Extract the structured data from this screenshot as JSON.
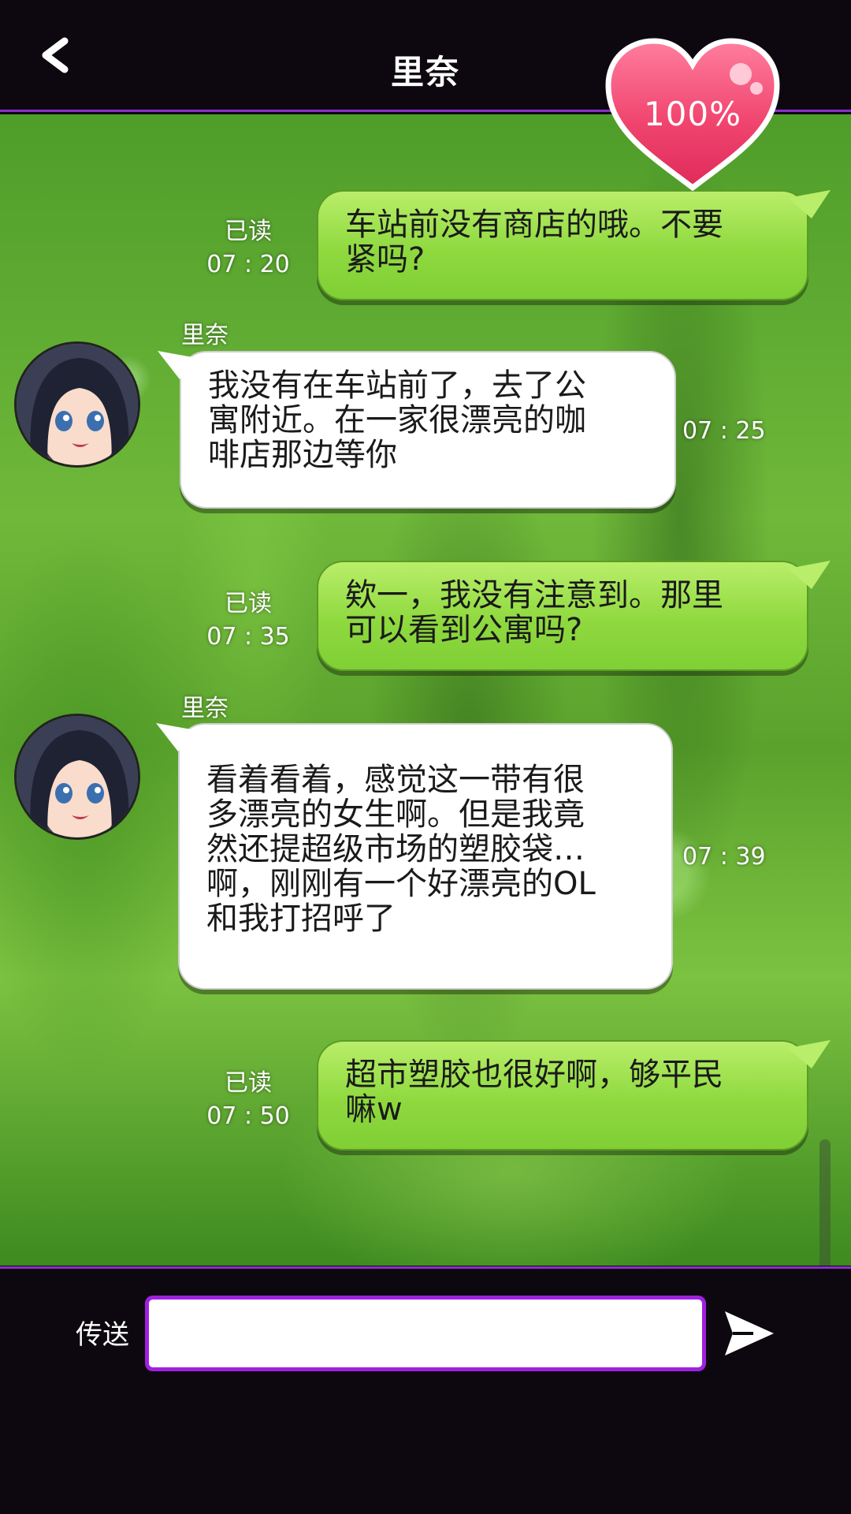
{
  "header": {
    "title": "里奈",
    "affection": "100%"
  },
  "messages": [
    {
      "side": "right",
      "status": "已读",
      "time": "07 : 20",
      "lines": [
        "车站前没有商店的哦。不要",
        "紧吗?"
      ]
    },
    {
      "side": "left",
      "sender": "里奈",
      "time": "07 : 25",
      "lines": [
        "我没有在车站前了，去了公",
        "寓附近。在一家很漂亮的咖",
        "啡店那边等你"
      ]
    },
    {
      "side": "right",
      "status": "已读",
      "time": "07 : 35",
      "lines": [
        "欸一，我没有注意到。那里",
        "可以看到公寓吗?"
      ]
    },
    {
      "side": "left",
      "sender": "里奈",
      "time": "07 : 39",
      "lines": [
        "看着看着，感觉这一带有很",
        "多漂亮的女生啊。但是我竟",
        "然还提超级市场的塑胶袋…",
        "啊，刚刚有一个好漂亮的OL",
        "和我打招呼了"
      ]
    },
    {
      "side": "right",
      "status": "已读",
      "time": "07 : 50",
      "lines": [
        "超市塑胶也很好啊，够平民",
        "嘛w"
      ]
    }
  ],
  "input": {
    "label": "传送",
    "value": "",
    "placeholder": ""
  },
  "colors": {
    "accent": "#8a2fc9",
    "bubble_green": "#8fd93f",
    "heart": "#f0456f"
  }
}
